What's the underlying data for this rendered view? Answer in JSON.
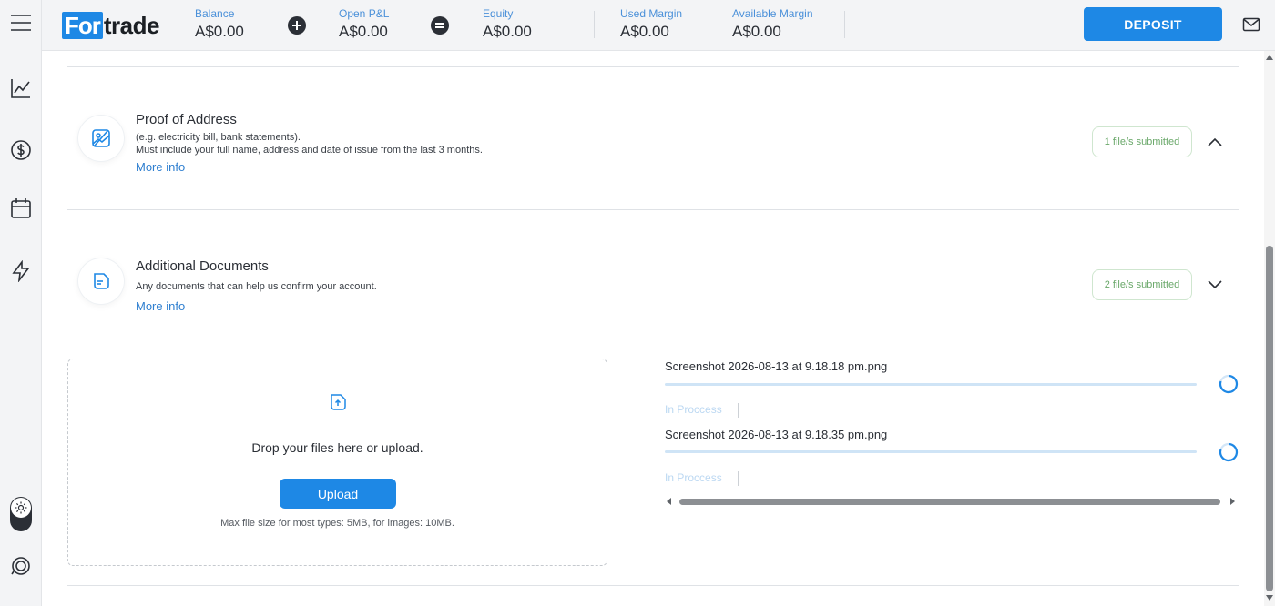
{
  "header": {
    "logo_box": "For",
    "logo_rest": "trade",
    "stats": [
      {
        "label": "Balance",
        "value": "A$0.00"
      },
      {
        "label": "Open P&L",
        "value": "A$0.00"
      },
      {
        "label": "Equity",
        "value": "A$0.00"
      },
      {
        "label": "Used Margin",
        "value": "A$0.00"
      },
      {
        "label": "Available Margin",
        "value": "A$0.00"
      }
    ],
    "deposit_label": "DEPOSIT"
  },
  "sections": {
    "proof_of_address": {
      "title": "Proof of Address",
      "desc_line1": "(e.g. electricity bill, bank statements).",
      "desc_line2": "Must include your full name, address and date of issue from the last 3 months.",
      "more_info": "More info",
      "badge": "1  file/s submitted"
    },
    "additional_documents": {
      "title": "Additional Documents",
      "desc": "Any documents that can help us confirm your account.",
      "more_info": "More info",
      "badge": "2  file/s submitted"
    }
  },
  "upload": {
    "drop_text": "Drop your files here or upload.",
    "button": "Upload",
    "max_text": "Max file size for most types: 5MB, for images: 10MB."
  },
  "files": [
    {
      "name": "Screenshot 2026-08-13 at 9.18.18 pm.png",
      "status": "In Proccess"
    },
    {
      "name": "Screenshot 2026-08-13 at 9.18.35 pm.png",
      "status": "In Proccess"
    }
  ],
  "colors": {
    "accent": "#1e88e5",
    "link": "#2f7fd0",
    "badge_text": "#6aa86a"
  }
}
